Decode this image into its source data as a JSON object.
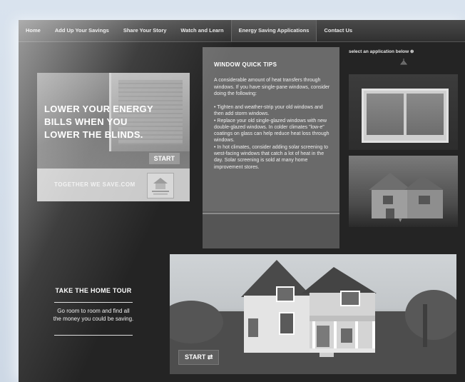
{
  "nav": {
    "items": [
      "Home",
      "Add Up Your Savings",
      "Share Your Story",
      "Watch and Learn",
      "Energy Saving Applications",
      "Contact Us"
    ],
    "active": "Energy Saving Applications"
  },
  "ad": {
    "headline": "LOWER YOUR ENERGY BILLS WHEN YOU LOWER THE BLINDS.",
    "start_label": "START",
    "footer_text": "TOGETHER WE SAVE.COM",
    "logo_icon": "utility-logo-icon"
  },
  "tips": {
    "title": "WINDOW QUICK TIPS",
    "intro": "A considerable amount of heat transfers through windows. If you have single-pane windows, consider doing the following:",
    "items": [
      "• Tighten and weather-strip your old windows and then add storm windows.",
      "• Replace your old single-glazed windows with new double-glazed windows. In colder climates \"low-e\" coatings on glass can help reduce heat loss through windows.",
      "• In hot climates, consider adding solar screening to west-facing windows that catch a lot of heat in the day. Solar screening is sold at many home improvement stores."
    ]
  },
  "applications": {
    "select_label": "select an application below ⊛"
  },
  "tour": {
    "title": "TAKE THE HOME TOUR",
    "text": "Go room to room and find all the money you could be saving.",
    "start_label": "START ⇄"
  },
  "colors": {
    "background": "#242424",
    "nav": "#3a3a3a",
    "tips_panel": "#6a6a6a"
  }
}
